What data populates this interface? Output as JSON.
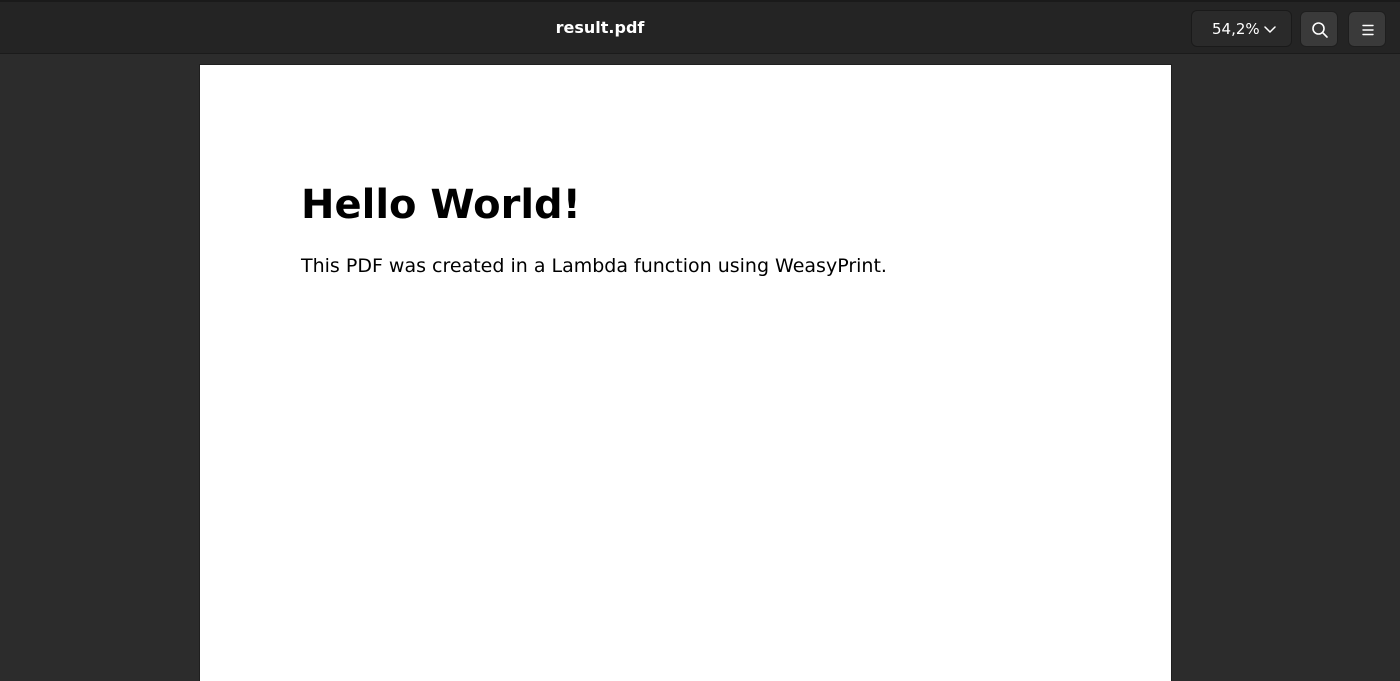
{
  "window": {
    "title": "result.pdf"
  },
  "toolbar": {
    "zoom_level": "54,2%",
    "zoom_icon": "chevron-down-icon",
    "search_icon": "search-icon",
    "menu_icon": "hamburger-menu-icon"
  },
  "document": {
    "heading": "Hello World!",
    "body": "This PDF was created in a Lambda function using WeasyPrint."
  },
  "colors": {
    "headerbar": "#242424",
    "background": "#2c2c2c",
    "page": "#ffffff",
    "text": "#000000"
  }
}
